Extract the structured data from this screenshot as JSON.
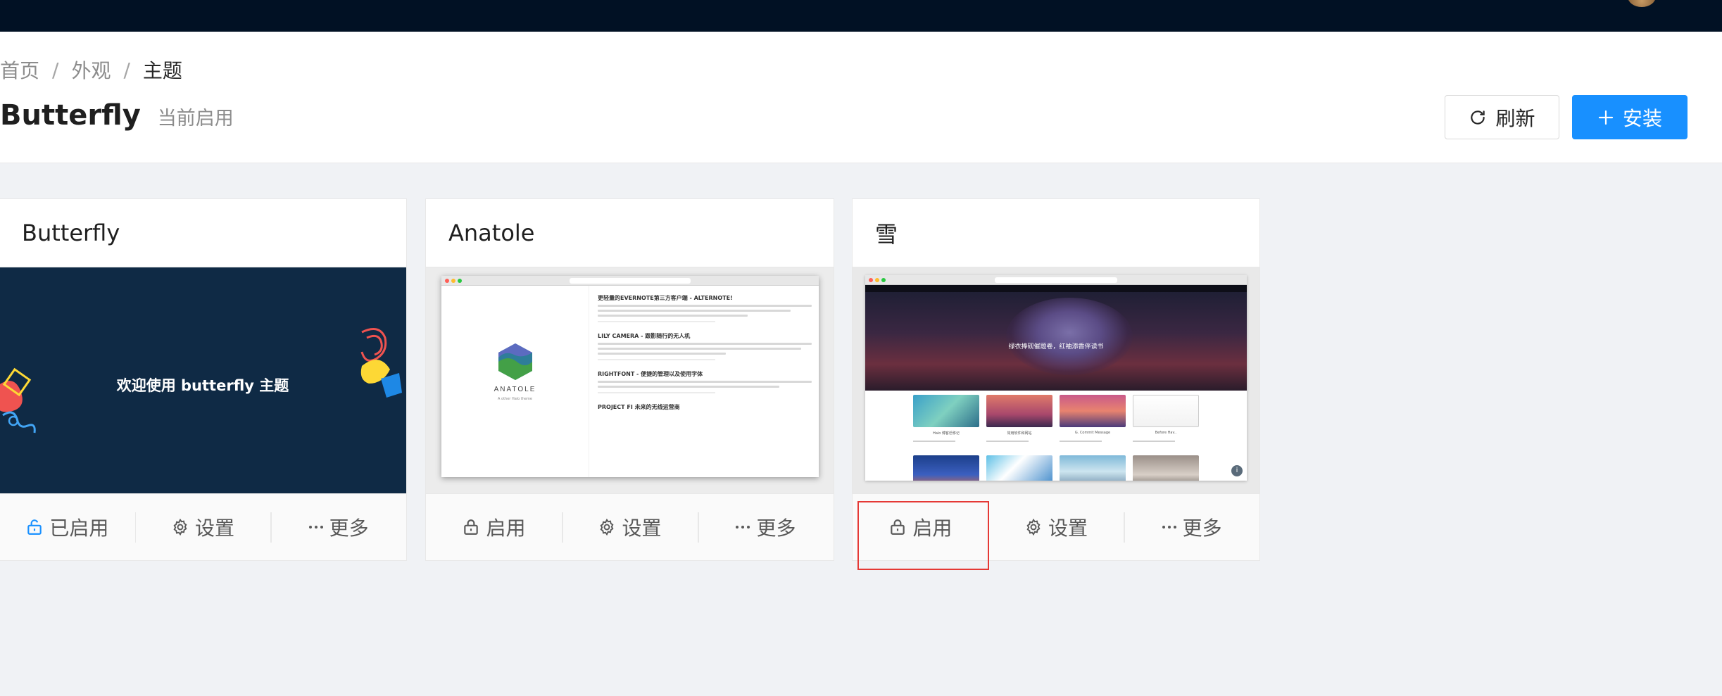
{
  "breadcrumb": {
    "items": [
      "首页",
      "外观",
      "主题"
    ]
  },
  "header": {
    "title": "Butterfly",
    "subtitle": "当前启用",
    "refresh_label": "刷新",
    "install_label": "安装"
  },
  "themes": [
    {
      "name": "Butterfly",
      "cover_text": "欢迎使用 butterfly 主题",
      "actions": {
        "enable": "已启用",
        "settings": "设置",
        "more": "更多"
      },
      "enabled": true
    },
    {
      "name": "Anatole",
      "cover_logo": "ANATOLE",
      "cover_tagline": "A other Halo theme",
      "cover_posts": [
        "更轻量的EVERNOTE第三方客户端 - ALTERNOTE!",
        "LILY CAMERA - 跟影随行的无人机",
        "RIGHTFONT - 便捷的管理以及使用字体",
        "PROJECT FI 未来的无线运营商"
      ],
      "actions": {
        "enable": "启用",
        "settings": "设置",
        "more": "更多"
      },
      "enabled": false
    },
    {
      "name": "雪",
      "cover_slogan": "绿衣捧砚催题卷，红袖添香伴读书",
      "cover_thumbs": [
        "Halo 博客迁移记",
        "常用软件和网站",
        "G. Commit Message",
        "Before Hav.."
      ],
      "actions": {
        "enable": "启用",
        "settings": "设置",
        "more": "更多"
      },
      "enabled": false
    }
  ],
  "colors": {
    "primary": "#1890ff",
    "topbar": "#011124",
    "highlight": "#e53935"
  }
}
